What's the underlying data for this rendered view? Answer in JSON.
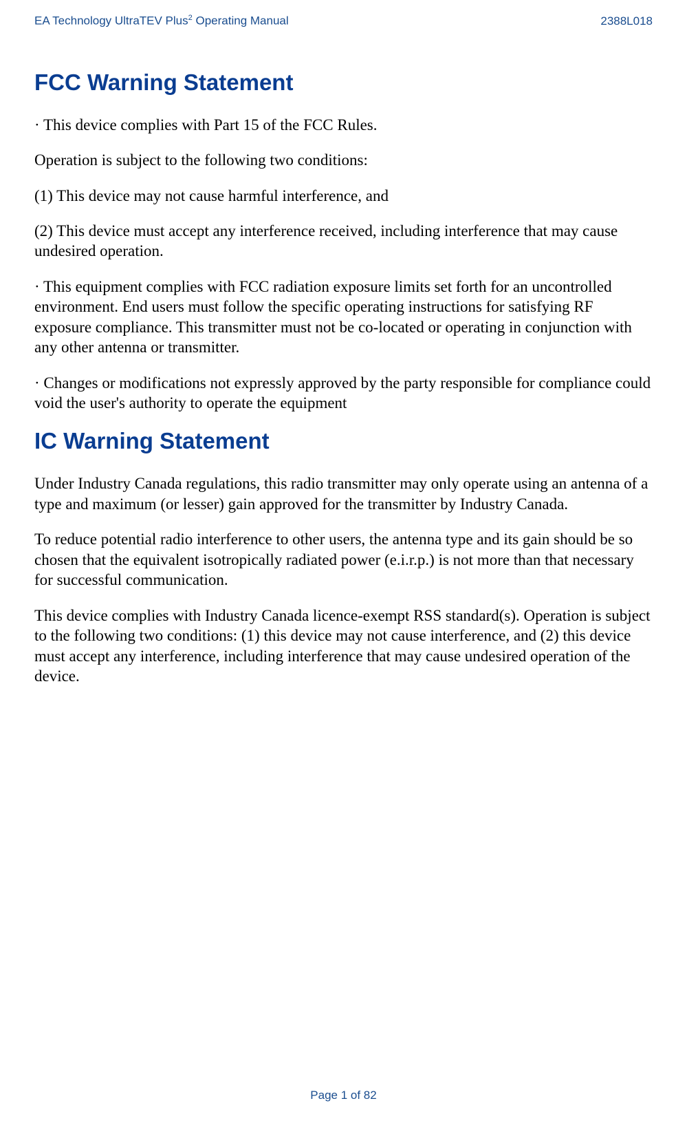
{
  "header": {
    "left_prefix": "EA Technology UltraTEV Plus",
    "left_sup": "2",
    "left_suffix": " Operating Manual",
    "right": "2388L018"
  },
  "section1": {
    "title": "FCC Warning Statement",
    "p1": "· This device complies with Part 15 of the FCC Rules.",
    "p2": "Operation is subject to the following two conditions:",
    "p3": "(1) This device may not cause harmful interference, and",
    "p4": "(2) This device must accept any interference received, including interference that may cause undesired operation.",
    "p5": "· This equipment complies with FCC radiation exposure limits set forth for an uncontrolled environment. End users must follow the specific operating instructions for satisfying RF exposure compliance. This transmitter must not be co-located or operating in conjunction with any other antenna or transmitter.",
    "p6": "· Changes or modifications not expressly approved by the party responsible for compliance could void the user's authority to operate the equipment"
  },
  "section2": {
    "title": "IC Warning Statement",
    "p1": "Under Industry Canada regulations, this radio transmitter may only operate using an antenna of a type and maximum (or lesser) gain approved for the transmitter by Industry Canada.",
    "p2": "To reduce potential radio interference to other users, the antenna type and its gain should be so chosen that the equivalent isotropically radiated power (e.i.r.p.) is not more than that necessary for successful communication.",
    "p3": "This device complies with Industry Canada licence-exempt RSS standard(s). Operation is subject to the following two conditions: (1) this device may not cause interference, and (2) this device must accept any interference, including interference that may cause undesired operation of the device."
  },
  "footer": {
    "text": "Page 1 of 82"
  }
}
